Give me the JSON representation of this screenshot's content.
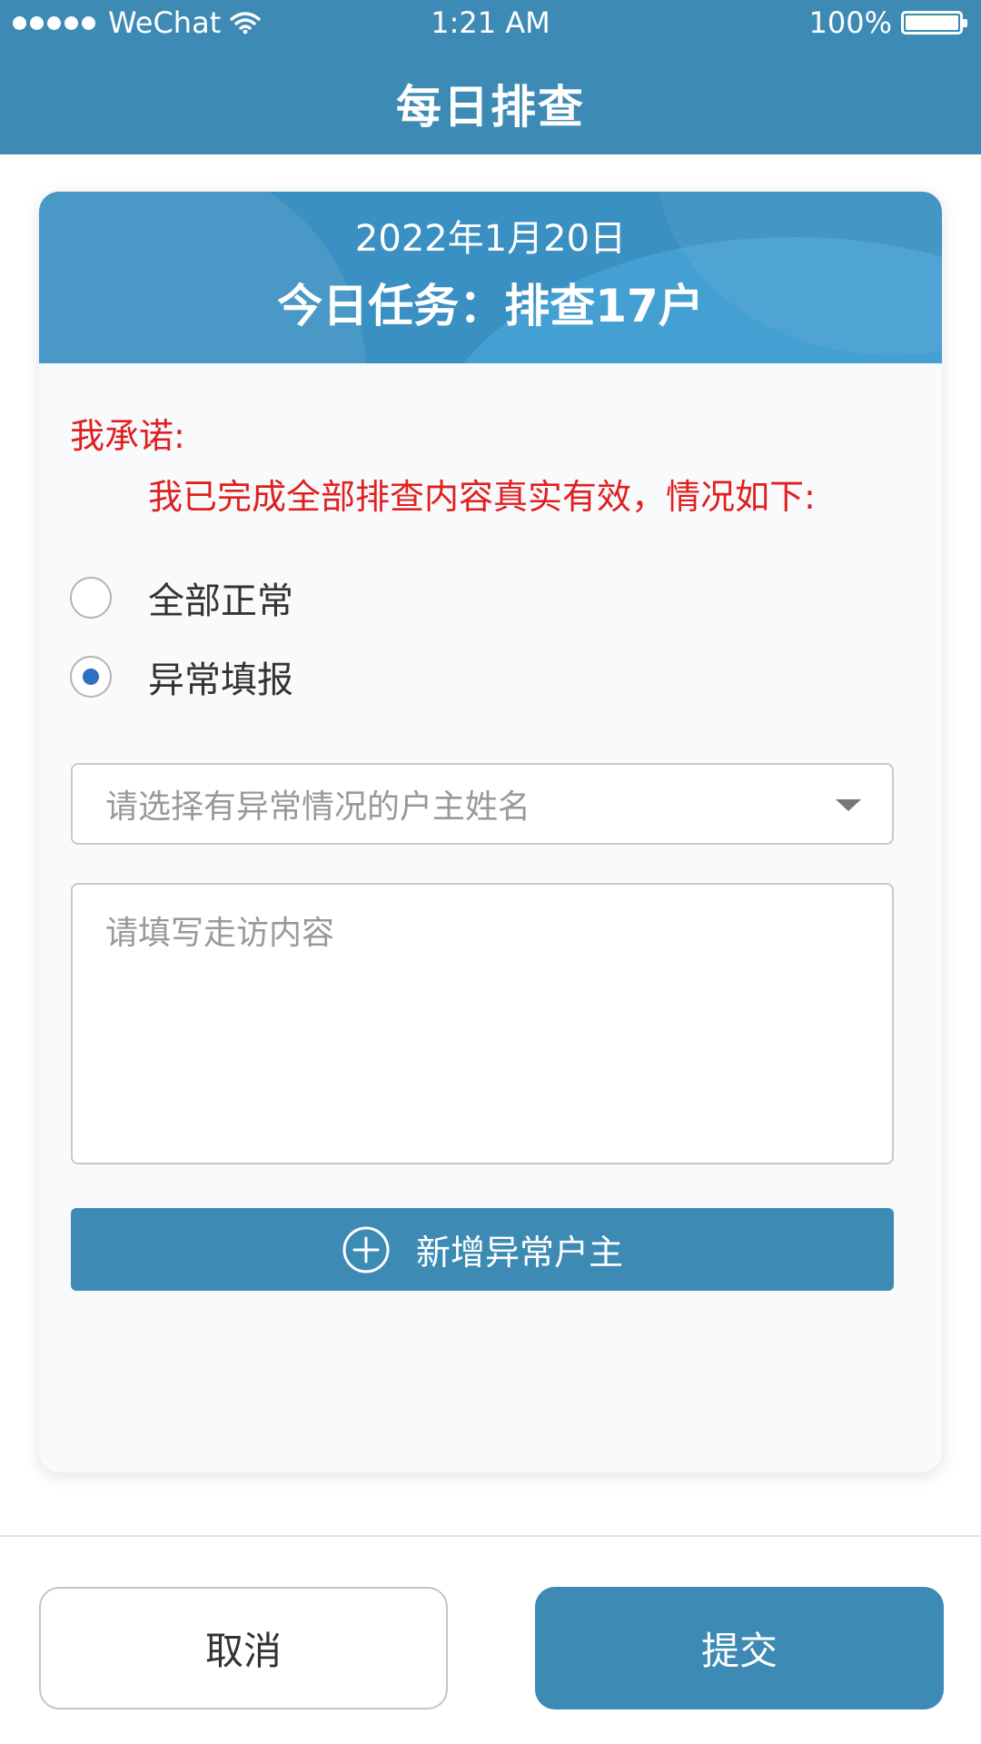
{
  "status_bar": {
    "carrier": "WeChat",
    "time": "1:21 AM",
    "battery": "100%"
  },
  "header": {
    "title": "每日排查"
  },
  "banner": {
    "date": "2022年1月20日",
    "task": "今日任务：排查17户"
  },
  "pledge": {
    "title": "我承诺:",
    "text": "我已完成全部排查内容真实有效，情况如下:"
  },
  "options": {
    "all_normal_label": "全部正常",
    "abnormal_label": "异常填报",
    "selected": "异常填报"
  },
  "form": {
    "householder_placeholder": "请选择有异常情况的户主姓名",
    "visit_placeholder": "请填写走访内容",
    "add_button_label": "新增异常户主"
  },
  "footer": {
    "cancel_label": "取消",
    "submit_label": "提交"
  },
  "colors": {
    "primary": "#3d8bb5",
    "warning_text": "#e02020",
    "radio_selected": "#2f6fc0"
  },
  "icons": {
    "signal": "signal-dots-icon",
    "wifi": "wifi-icon",
    "battery": "battery-icon",
    "dropdown": "chevron-down-icon",
    "add": "plus-circle-icon"
  }
}
